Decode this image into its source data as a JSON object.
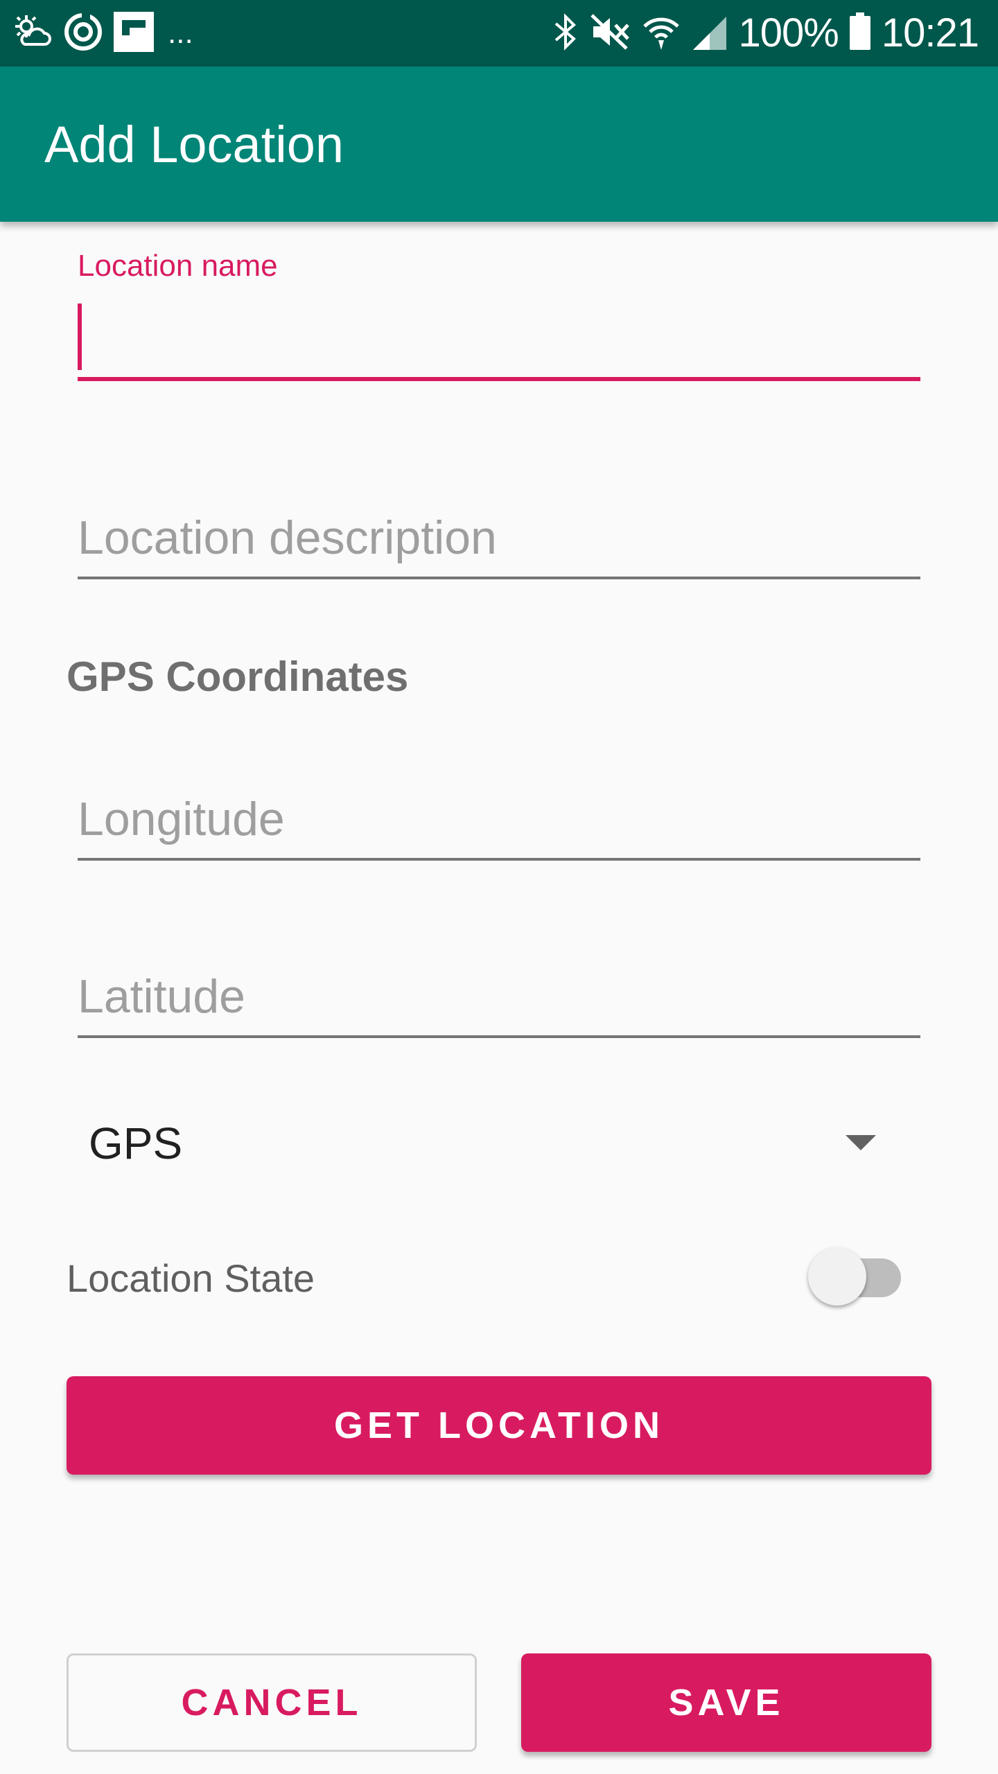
{
  "status_bar": {
    "overflow": "...",
    "battery": "100%",
    "time": "10:21",
    "left_icons": [
      "weather-icon",
      "sync-icon",
      "flipboard-icon"
    ],
    "right_icons": [
      "bluetooth-icon",
      "mute-icon",
      "wifi-icon",
      "signal-icon",
      "battery-icon"
    ]
  },
  "app_bar": {
    "title": "Add Location"
  },
  "form": {
    "name": {
      "label": "Location name",
      "value": ""
    },
    "description": {
      "placeholder": "Location description",
      "value": ""
    },
    "gps_section_title": "GPS Coordinates",
    "longitude": {
      "placeholder": "Longitude",
      "value": ""
    },
    "latitude": {
      "placeholder": "Latitude",
      "value": ""
    },
    "source_select": {
      "selected": "GPS"
    },
    "state_switch": {
      "label": "Location State",
      "on": false
    }
  },
  "buttons": {
    "get_location": "GET LOCATION",
    "cancel": "CANCEL",
    "save": "SAVE"
  },
  "colors": {
    "status_bar": "#00574b",
    "app_bar": "#008577",
    "accent": "#d81b60"
  }
}
